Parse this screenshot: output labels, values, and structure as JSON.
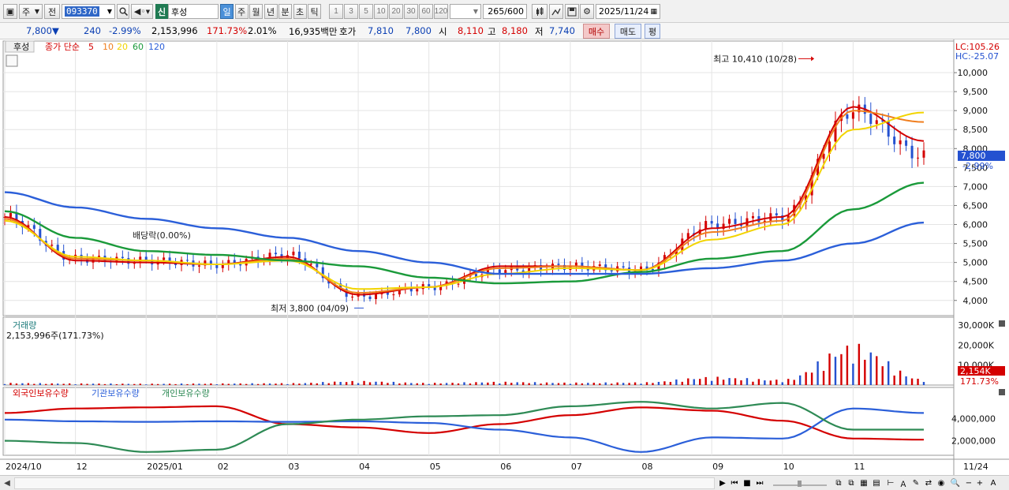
{
  "toolbar": {
    "market_type": "주",
    "prev_label": "전",
    "stock_code": "093370",
    "sin_badge": "신",
    "stock_name": "후성",
    "periods": [
      "일",
      "주",
      "월",
      "년",
      "분",
      "초",
      "틱"
    ],
    "active_period": "일",
    "intervals": [
      "1",
      "3",
      "5",
      "10",
      "20",
      "30",
      "60",
      "120"
    ],
    "count_display": "265/600",
    "date": "2025/11/24"
  },
  "quote": {
    "price": "7,800",
    "arrow": "▼",
    "change": "240",
    "change_pct": "-2.99%",
    "volume": "2,153,996",
    "volume_ratio": "171.73%",
    "turnover_pct": "2.01%",
    "amount": "16,935백만",
    "bidask_label": "호가",
    "ask": "7,810",
    "bid": "7,800",
    "open_label": "시",
    "open": "8,110",
    "high_label": "고",
    "high": "8,180",
    "low_label": "저",
    "low": "7,740",
    "buy_label": "매수",
    "sell_label": "매도",
    "eval_label": "평"
  },
  "price_panel": {
    "legend": {
      "name": "후성",
      "ma_title": "종가 단순",
      "periods": [
        "5",
        "10",
        "20",
        "60",
        "120"
      ],
      "colors": [
        "#d40000",
        "#f07e1e",
        "#f2d400",
        "#1a9a3a",
        "#2b5fd9"
      ]
    },
    "lc_label": "LC:105.26",
    "hc_label": "HC:-25.07",
    "y_ticks": [
      "10,000",
      "9,500",
      "9,000",
      "8,500",
      "8,000",
      "7,500",
      "7,000",
      "6,500",
      "6,000",
      "5,500",
      "5,000",
      "4,500",
      "4,000"
    ],
    "y_tick_values": [
      10000,
      9500,
      9000,
      8500,
      8000,
      7500,
      7000,
      6500,
      6000,
      5500,
      5000,
      4500,
      4000
    ],
    "current_price_label": "7,800",
    "current_change_label": "-2.99%",
    "annotation_high": "최고 10,410 (10/28)",
    "annotation_low": "최저 3,800 (04/09)",
    "annotation_dividend": "배당락(0.00%)"
  },
  "volume_panel": {
    "title": "거래량",
    "subtitle": "2,153,996주(171.73%)",
    "y_ticks": [
      "30,000K",
      "20,000K",
      "10,000K"
    ],
    "y_tick_values": [
      30000,
      20000,
      10000
    ],
    "current_label": "2,154K",
    "current_ratio_label": "171.73%"
  },
  "holdings_panel": {
    "series_names": [
      "외국인보유수량",
      "기관보유수량",
      "개인보유수량"
    ],
    "colors": [
      "#d40000",
      "#2b5fd9",
      "#2e8a55"
    ],
    "y_ticks": [
      "4,000,000",
      "2,000,000"
    ],
    "y_tick_values": [
      4000000,
      2000000
    ]
  },
  "x_axis": {
    "labels": [
      "2024/10",
      "12",
      "2025/01",
      "02",
      "03",
      "04",
      "05",
      "06",
      "07",
      "08",
      "09",
      "10",
      "11"
    ],
    "last_date_label": "11/24"
  },
  "chart_data": [
    {
      "type": "candlestick",
      "title": "후성",
      "ylim": [
        3600,
        10500
      ],
      "x": [
        "2024/10",
        "12",
        "2025/01",
        "02",
        "03",
        "04",
        "05",
        "06",
        "07",
        "08",
        "09",
        "10",
        "11",
        "11/24"
      ],
      "close_approx": [
        6200,
        5100,
        5050,
        4950,
        5200,
        4100,
        4350,
        4800,
        4900,
        4800,
        6000,
        6200,
        9000,
        7800
      ],
      "series": [
        {
          "name": "5",
          "values": [
            6200,
            5050,
            5000,
            4950,
            5150,
            4150,
            4350,
            4900,
            4900,
            4800,
            5900,
            6200,
            9100,
            8200
          ]
        },
        {
          "name": "10",
          "values": [
            6150,
            5100,
            5050,
            4950,
            5100,
            4200,
            4350,
            4850,
            4900,
            4800,
            5800,
            6100,
            9000,
            8700
          ]
        },
        {
          "name": "20",
          "values": [
            6100,
            5150,
            5050,
            4950,
            5050,
            4300,
            4350,
            4700,
            4850,
            4800,
            5600,
            6000,
            8500,
            8950
          ]
        },
        {
          "name": "60",
          "values": [
            6350,
            5650,
            5300,
            5200,
            5050,
            4900,
            4600,
            4450,
            4500,
            4750,
            5100,
            5300,
            6400,
            7100
          ]
        },
        {
          "name": "120",
          "values": [
            6850,
            6450,
            6150,
            5900,
            5650,
            5300,
            5000,
            4700,
            4700,
            4700,
            4850,
            5050,
            5500,
            6050
          ]
        }
      ],
      "high": 10410,
      "high_date": "10/28",
      "low": 3800,
      "low_date": "04/09"
    },
    {
      "type": "bar",
      "title": "거래량",
      "ylim": [
        0,
        30000
      ],
      "x": [
        "2024/10",
        "12",
        "2025/01",
        "02",
        "03",
        "04",
        "05",
        "06",
        "07",
        "08",
        "09",
        "10",
        "11",
        "11/24"
      ],
      "values": [
        800,
        600,
        500,
        600,
        700,
        1500,
        800,
        1200,
        900,
        1000,
        3000,
        2000,
        15000,
        2154
      ]
    },
    {
      "type": "line",
      "title": "",
      "ylim": [
        700000,
        5800000
      ],
      "x": [
        "2024/10",
        "12",
        "2025/01",
        "02",
        "03",
        "04",
        "05",
        "06",
        "07",
        "08",
        "09",
        "10",
        "11",
        "11/24"
      ],
      "series": [
        {
          "name": "외국인보유수량",
          "values": [
            4500000,
            4900000,
            5000000,
            5100000,
            3500000,
            3200000,
            2700000,
            3500000,
            4300000,
            5000000,
            4700000,
            3800000,
            2200000,
            2100000
          ]
        },
        {
          "name": "기관보유수량",
          "values": [
            3900000,
            3750000,
            3700000,
            3750000,
            3700000,
            3750000,
            3600000,
            3000000,
            2300000,
            1000000,
            2300000,
            2200000,
            4900000,
            4500000
          ]
        },
        {
          "name": "개인보유수량",
          "values": [
            2000000,
            1800000,
            1000000,
            1200000,
            3500000,
            3900000,
            4200000,
            4300000,
            5100000,
            5500000,
            4900000,
            5400000,
            3000000,
            3000000
          ]
        }
      ]
    }
  ]
}
